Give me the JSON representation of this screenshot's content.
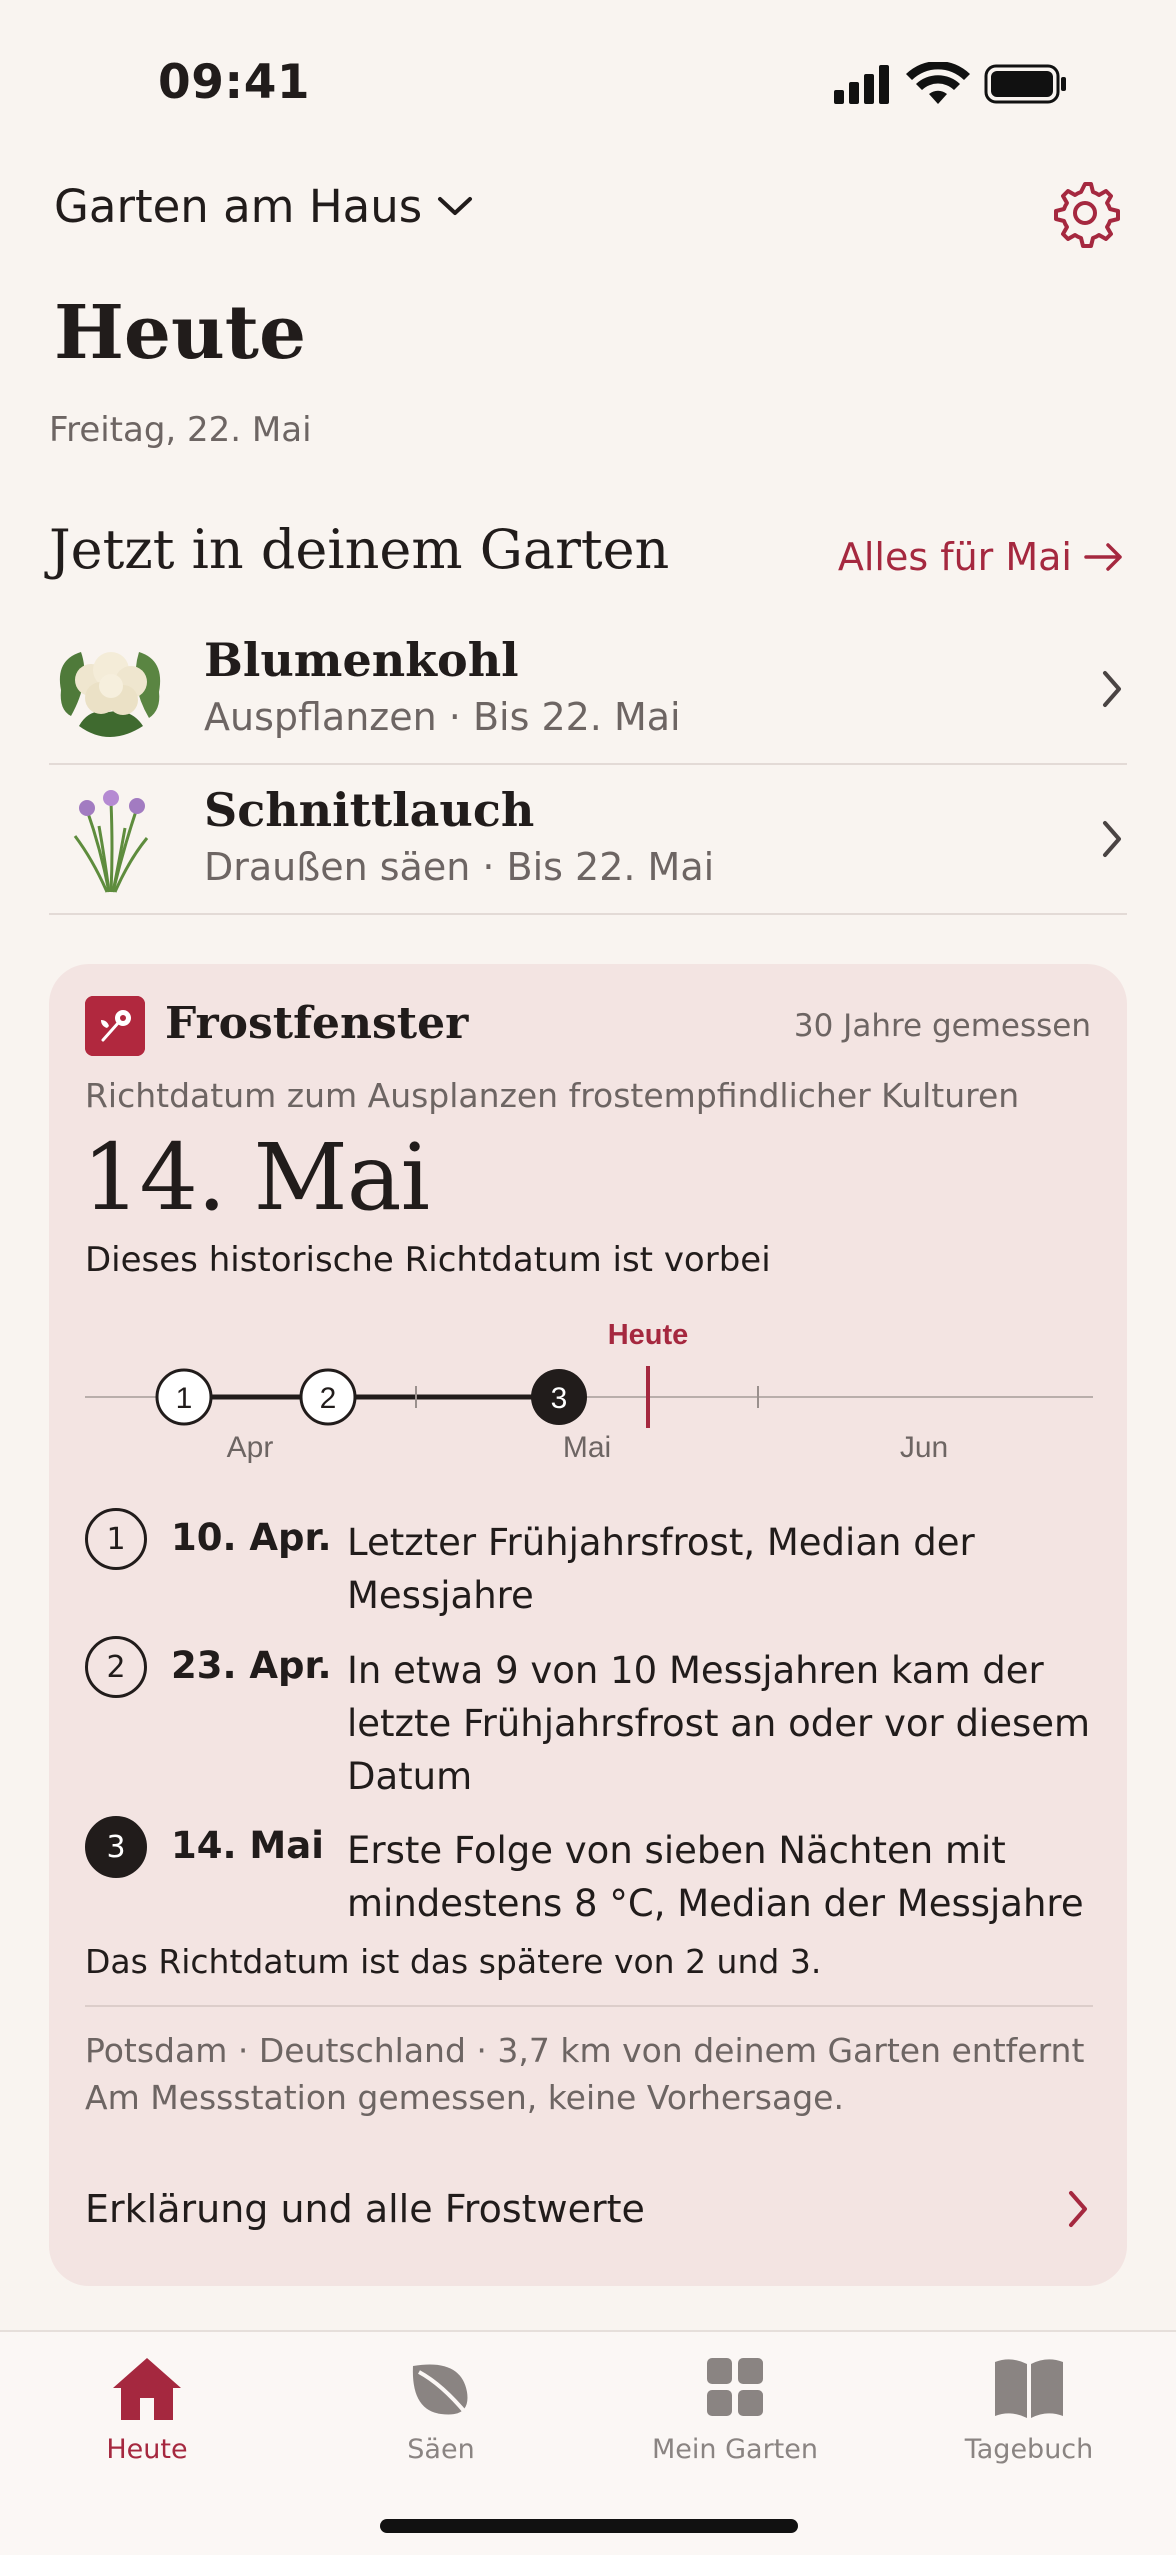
{
  "status_bar": {
    "time": "09:41"
  },
  "header": {
    "garden_name": "Garten am Haus",
    "title": "Heute",
    "date": "Freitag, 22. Mai"
  },
  "section": {
    "title": "Jetzt in deinem Garten",
    "link_label": "Alles für Mai"
  },
  "crops": [
    {
      "name": "Blumenkohl",
      "detail": "Auspflanzen · Bis 22. Mai",
      "icon": "cauliflower-icon"
    },
    {
      "name": "Schnittlauch",
      "detail": "Draußen säen · Bis 22. Mai",
      "icon": "chives-icon"
    }
  ],
  "frost_card": {
    "title": "Frostfenster",
    "years_label": "30 Jahre gemessen",
    "description": "Richtdatum zum Ausplanzen frostempfindlicher Kulturen",
    "target_date": "14. Mai",
    "status": "Dieses historische Richtdatum ist vorbei",
    "timeline": {
      "today_label": "Heute",
      "months": [
        "Apr",
        "Mai",
        "Jun"
      ],
      "markers": [
        "1",
        "2",
        "3"
      ]
    },
    "legend": [
      {
        "num": "1",
        "date": "10. Apr.",
        "text": "Letzter Frühjahrsfrost, Median der Messjahre"
      },
      {
        "num": "2",
        "date": "23. Apr.",
        "text": "In etwa 9 von 10 Messjahren kam der letzte Frühjahrsfrost an oder vor diesem Datum"
      },
      {
        "num": "3",
        "date": "14. Mai",
        "text": "Erste Folge von sieben Nächten mit mindestens 8 °C, Median der Messjahre"
      }
    ],
    "note": "Das Richtdatum ist das spätere von 2 und 3.",
    "source_line1": "Potsdam · Deutschland · 3,7 km von deinem Garten entfernt",
    "source_line2": "Am Messstation gemessen, keine Vorhersage.",
    "explain_label": "Erklärung und alle Frostwerte"
  },
  "tabs": [
    {
      "label": "Heute",
      "icon": "house-icon",
      "active": true
    },
    {
      "label": "Säen",
      "icon": "leaf-icon",
      "active": false
    },
    {
      "label": "Mein Garten",
      "icon": "grid-icon",
      "active": false
    },
    {
      "label": "Tagebuch",
      "icon": "book-icon",
      "active": false
    }
  ],
  "colors": {
    "accent": "#a5283f",
    "background": "#f9f4f0",
    "card": "#f3e4e2"
  }
}
